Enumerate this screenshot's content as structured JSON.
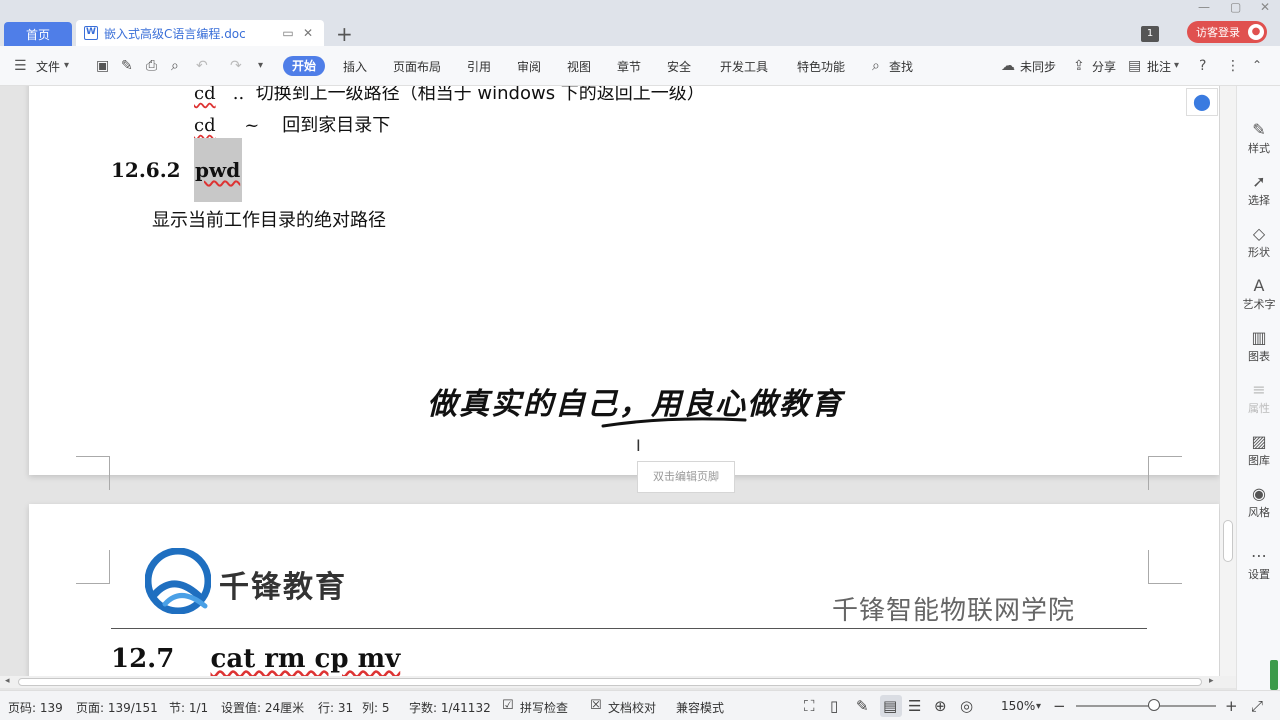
{
  "tabs": {
    "home_label": "首页",
    "doc_title": "嵌入式高级C语言编程.doc",
    "doc_icon": "W",
    "add_symbol": "+"
  },
  "window": {
    "page_badge": "1",
    "login_label": "访客登录"
  },
  "toolbar": {
    "file_label": "文件",
    "menus": [
      "开始",
      "插入",
      "页面布局",
      "引用",
      "审阅",
      "视图",
      "章节",
      "安全",
      "开发工具",
      "特色功能"
    ],
    "search_label": "查找",
    "sync_label": "未同步",
    "share_label": "分享",
    "comment_label": "批注"
  },
  "document": {
    "line_cd_up_cmd": "cd",
    "line_cd_up_arg": "..",
    "line_cd_up_desc": "切换到上一级路径（相当于 windows 下的返回上一级）",
    "line_cd_home_cmd": "cd",
    "line_cd_home_arg": "~",
    "line_cd_home_desc": "回到家目录下",
    "section_num": "12.6.2",
    "section_title": "pwd",
    "pwd_desc": "显示当前工作目录的绝对路径",
    "slogan": "做真实的自己，用良心做教育",
    "footer_hint": "双击编辑页脚",
    "logo_text": "千锋教育",
    "college_name": "千锋智能物联网学院",
    "next_section_num": "12.7",
    "next_section_title": "cat rm cp mv"
  },
  "right_panel": [
    {
      "label": "样式",
      "icon": "pen-icon"
    },
    {
      "label": "选择",
      "icon": "cursor-icon"
    },
    {
      "label": "形状",
      "icon": "shape-icon"
    },
    {
      "label": "艺术字",
      "icon": "wordart-icon"
    },
    {
      "label": "图表",
      "icon": "chart-icon"
    },
    {
      "label": "属性",
      "icon": "property-icon"
    },
    {
      "label": "图库",
      "icon": "gallery-icon"
    },
    {
      "label": "风格",
      "icon": "style-icon"
    },
    {
      "label": "设置",
      "icon": "more-icon"
    }
  ],
  "status": {
    "page_code": "页码: 139",
    "page": "页面: 139/151",
    "section": "节: 1/1",
    "setting": "设置值: 24厘米",
    "row": "行: 31",
    "col": "列: 5",
    "words": "字数: 1/41132",
    "spellcheck": "拼写检查",
    "doc_proof": "文档校对",
    "compat": "兼容模式",
    "zoom": "150%"
  },
  "colors": {
    "accent": "#4f7ee8",
    "login": "#e0514f",
    "logo_blue": "#1f6fc0"
  }
}
